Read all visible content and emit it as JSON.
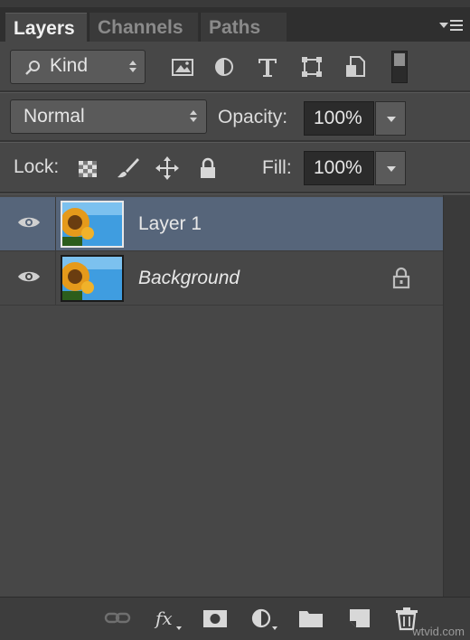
{
  "tabs": [
    {
      "label": "Layers",
      "active": true
    },
    {
      "label": "Channels",
      "active": false
    },
    {
      "label": "Paths",
      "active": false
    }
  ],
  "filter": {
    "kind_label": "Kind",
    "icons": [
      "search-icon",
      "pixel-filter-icon",
      "adjustment-filter-icon",
      "type-filter-icon",
      "shape-filter-icon",
      "smart-object-filter-icon"
    ]
  },
  "blend": {
    "mode": "Normal",
    "opacity_label": "Opacity:",
    "opacity_value": "100%"
  },
  "lock": {
    "label": "Lock:",
    "icons": [
      "lock-transparent-pixels-icon",
      "lock-image-pixels-icon",
      "lock-position-icon",
      "lock-all-icon"
    ],
    "fill_label": "Fill:",
    "fill_value": "100%"
  },
  "layers": [
    {
      "name": "Layer 1",
      "selected": true,
      "visible": true,
      "locked": false,
      "italic": false
    },
    {
      "name": "Background",
      "selected": false,
      "visible": true,
      "locked": true,
      "italic": true
    }
  ],
  "bottom_icons": [
    "link-layers-icon",
    "fx-icon",
    "layer-mask-icon",
    "adjustment-layer-icon",
    "new-group-icon",
    "new-layer-icon",
    "trash-icon"
  ],
  "watermark": "wtvid.com",
  "colors": {
    "panel": "#474747",
    "selected_row": "#56657a",
    "tabbar": "#2f2f2f"
  }
}
